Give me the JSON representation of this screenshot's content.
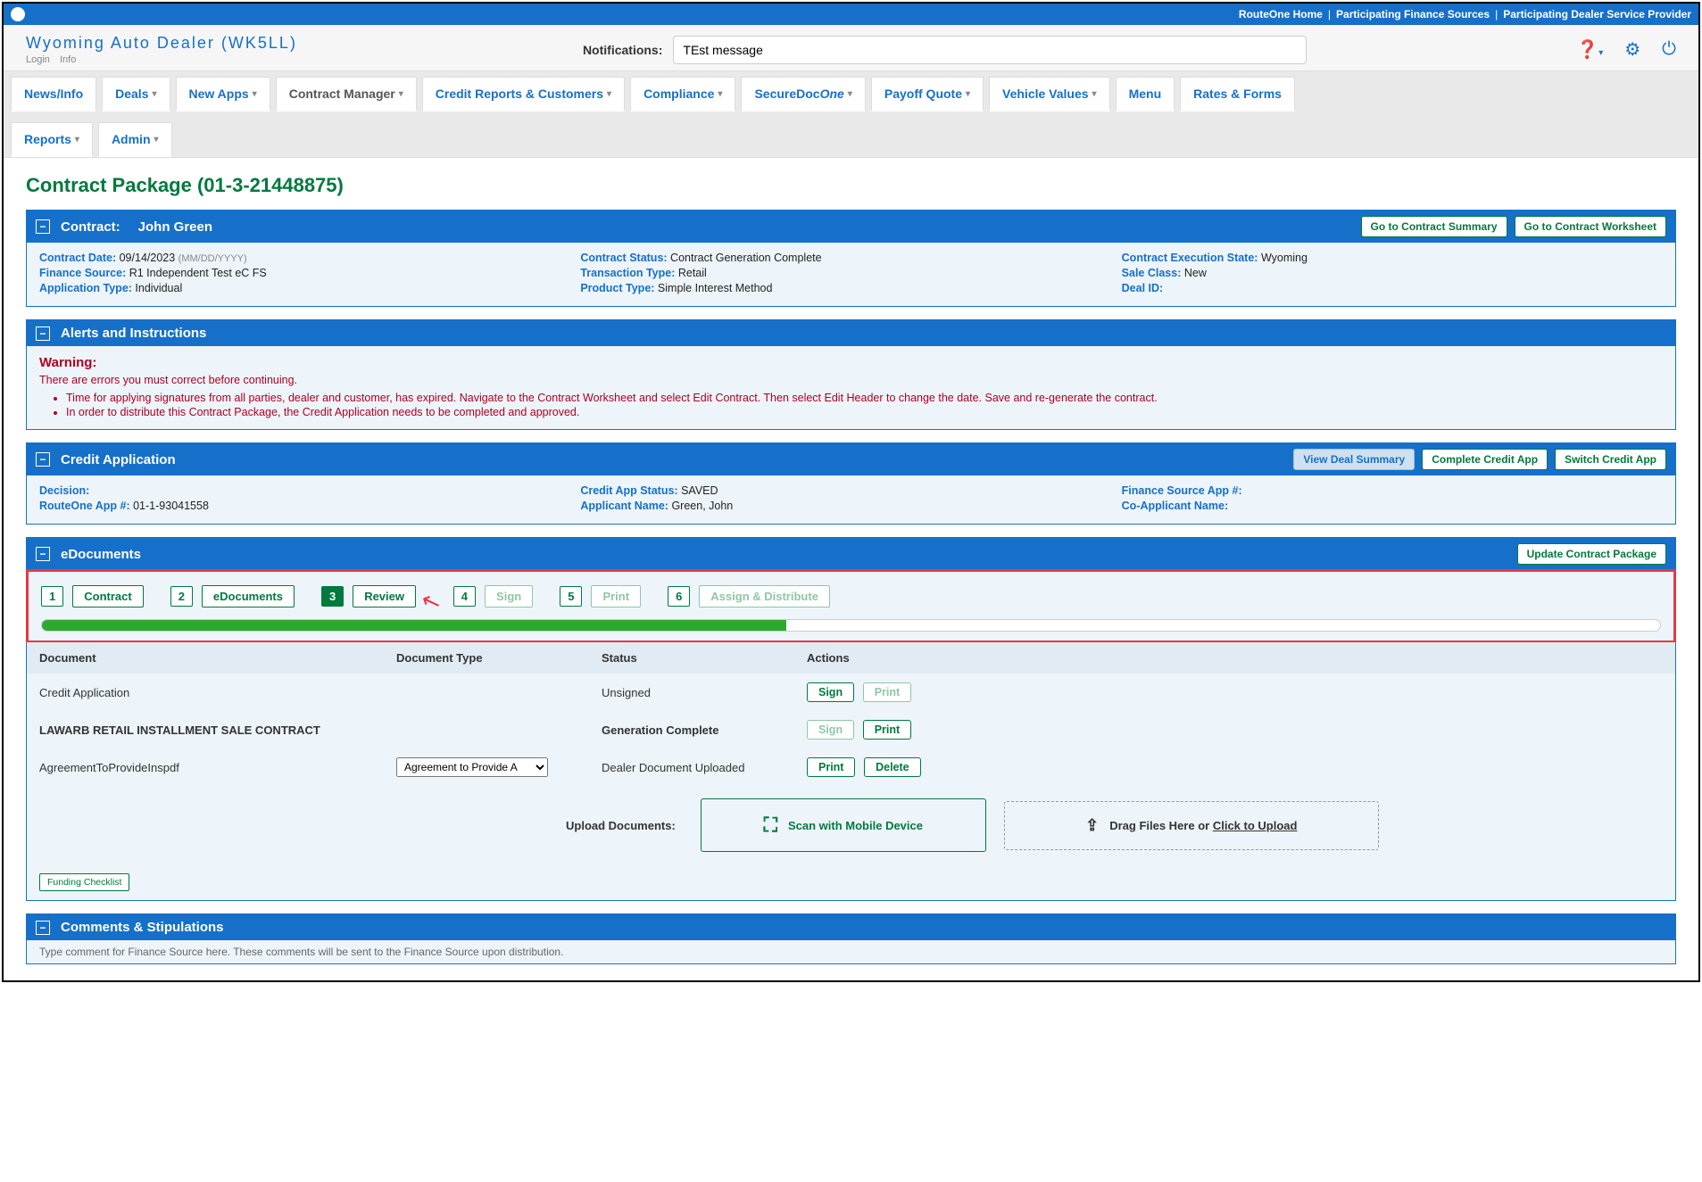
{
  "topbar": {
    "links": [
      "RouteOne Home",
      "Participating Finance Sources",
      "Participating Dealer Service Provider"
    ]
  },
  "header": {
    "dealer_name": "Wyoming Auto Dealer (WK5LL)",
    "sub_login": "Login",
    "sub_info": "Info",
    "notif_label": "Notifications:",
    "notif_value": "TEst message"
  },
  "nav": {
    "items": [
      "News/Info",
      "Deals",
      "New Apps",
      "Contract Manager",
      "Credit Reports & Customers",
      "Compliance",
      "SecureDoc",
      "Payoff Quote",
      "Vehicle Values",
      "Menu",
      "Rates & Forms",
      "Reports",
      "Admin"
    ],
    "securedoc_suffix": "One",
    "active_index": 3
  },
  "page": {
    "title": "Contract Package (01-3-21448875)"
  },
  "contract_panel": {
    "title": "Contract:",
    "name": "John Green",
    "btn_summary": "Go to Contract Summary",
    "btn_worksheet": "Go to Contract Worksheet",
    "col1": {
      "date_label": "Contract Date:",
      "date_val": "09/14/2023",
      "date_hint": "(MM/DD/YYYY)",
      "fs_label": "Finance Source:",
      "fs_val": "R1 Independent Test eC FS",
      "app_label": "Application Type:",
      "app_val": "Individual"
    },
    "col2": {
      "status_label": "Contract Status:",
      "status_val": "Contract Generation Complete",
      "trans_label": "Transaction Type:",
      "trans_val": "Retail",
      "prod_label": "Product Type:",
      "prod_val": "Simple Interest Method"
    },
    "col3": {
      "exec_label": "Contract Execution State:",
      "exec_val": "Wyoming",
      "sale_label": "Sale Class:",
      "sale_val": "New",
      "deal_label": "Deal ID:",
      "deal_val": ""
    }
  },
  "alerts_panel": {
    "title": "Alerts and Instructions",
    "warning_title": "Warning:",
    "warning_sub": "There are errors you must correct before continuing.",
    "items": [
      "Time for applying signatures from all parties, dealer and customer, has expired. Navigate to the Contract Worksheet and select Edit Contract. Then select Edit Header to change the date. Save and re-generate the contract.",
      "In order to distribute this Contract Package, the Credit Application needs to be completed and approved."
    ]
  },
  "credit_panel": {
    "title": "Credit Application",
    "btn_view": "View Deal Summary",
    "btn_complete": "Complete Credit App",
    "btn_switch": "Switch Credit App",
    "col1": {
      "dec_label": "Decision:",
      "dec_val": "",
      "app_label": "RouteOne App #:",
      "app_val": "01-1-93041558"
    },
    "col2": {
      "status_label": "Credit App Status:",
      "status_val": "SAVED",
      "name_label": "Applicant Name:",
      "name_val": "Green, John"
    },
    "col3": {
      "fs_label": "Finance Source App #:",
      "fs_val": "",
      "co_label": "Co-Applicant Name:",
      "co_val": ""
    }
  },
  "edoc_panel": {
    "title": "eDocuments",
    "btn_update": "Update Contract Package",
    "steps": [
      {
        "num": "1",
        "label": "Contract",
        "state": "done"
      },
      {
        "num": "2",
        "label": "eDocuments",
        "state": "done"
      },
      {
        "num": "3",
        "label": "Review",
        "state": "current"
      },
      {
        "num": "4",
        "label": "Sign",
        "state": "disabled"
      },
      {
        "num": "5",
        "label": "Print",
        "state": "disabled"
      },
      {
        "num": "6",
        "label": "Assign & Distribute",
        "state": "disabled"
      }
    ],
    "progress_pct": 46,
    "table_headers": [
      "Document",
      "Document Type",
      "Status",
      "Actions"
    ],
    "rows": [
      {
        "doc": "Credit Application",
        "doctype": "",
        "status": "Unsigned",
        "actions": [
          {
            "t": "Sign",
            "d": false
          },
          {
            "t": "Print",
            "d": true
          }
        ]
      },
      {
        "doc": "LAWARB RETAIL INSTALLMENT SALE CONTRACT",
        "bold": true,
        "doctype": "",
        "status": "Generation Complete",
        "actions": [
          {
            "t": "Sign",
            "d": true
          },
          {
            "t": "Print",
            "d": false
          }
        ]
      },
      {
        "doc": "AgreementToProvideInspdf",
        "doctype": "Agreement to Provide A",
        "status": "Dealer Document Uploaded",
        "actions": [
          {
            "t": "Print",
            "d": false
          },
          {
            "t": "Delete",
            "d": false
          }
        ]
      }
    ],
    "upload_label": "Upload Documents:",
    "scan_label": "Scan with Mobile Device",
    "drag_prefix": "Drag Files Here or ",
    "drag_link": "Click to Upload",
    "funding_btn": "Funding Checklist"
  },
  "comments_panel": {
    "title": "Comments & Stipulations",
    "note": "Type comment for Finance Source here. These comments will be sent to the Finance Source upon distribution."
  }
}
